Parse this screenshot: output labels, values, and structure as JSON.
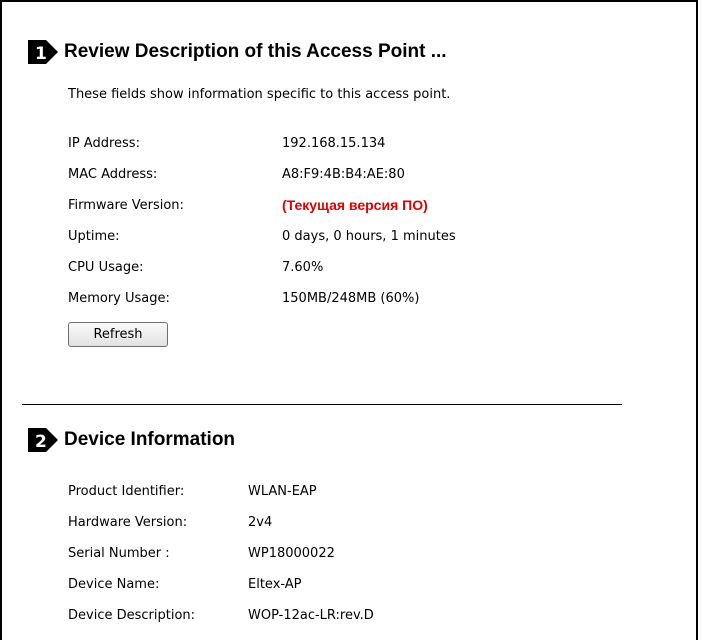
{
  "section1": {
    "step": "1",
    "title": "Review Description of this Access Point ...",
    "description": "These fields show information specific to this access point.",
    "fields": [
      {
        "label": "IP Address:",
        "value": "192.168.15.134"
      },
      {
        "label": "MAC Address:",
        "value": "A8:F9:4B:B4:AE:80"
      },
      {
        "label": "Firmware Version:",
        "value": "(Текущая версия ПО)"
      },
      {
        "label": "Uptime:",
        "value": "0 days, 0 hours, 1 minutes"
      },
      {
        "label": "CPU Usage:",
        "value": "7.60%"
      },
      {
        "label": "Memory Usage:",
        "value": "150MB/248MB (60%)"
      }
    ],
    "refresh_label": "Refresh"
  },
  "section2": {
    "step": "2",
    "title": "Device Information",
    "fields": [
      {
        "label": "Product Identifier:",
        "value": "WLAN-EAP"
      },
      {
        "label": "Hardware Version:",
        "value": "2v4"
      },
      {
        "label": "Serial Number :",
        "value": "WP18000022"
      },
      {
        "label": "Device Name:",
        "value": "Eltex-AP"
      },
      {
        "label": "Device Description:",
        "value": "WOP-12ac-LR:rev.D"
      }
    ]
  },
  "colors": {
    "firmware_value": "#e00000",
    "badge_fill": "#000000",
    "badge_text": "#ffffff"
  }
}
